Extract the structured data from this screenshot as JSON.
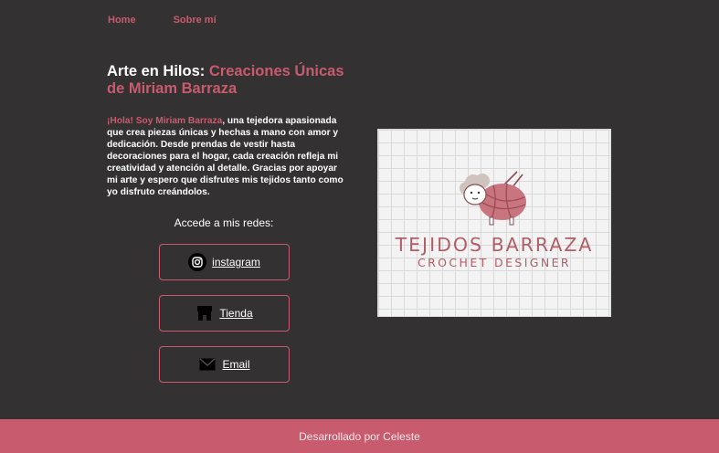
{
  "nav": {
    "home": "Home",
    "about": "Sobre mí"
  },
  "hero": {
    "title_plain": "Arte en Hilos: ",
    "title_accent": "Creaciones Únicas de Miriam Barraza"
  },
  "intro": {
    "greeting": "¡Hola! Soy Miriam Barraza",
    "body": ", una tejedora apasionada que crea piezas únicas y hechas a mano con amor y dedicación. Desde prendas de vestir hasta decoraciones para el hogar, cada creación refleja mi creatividad y atención al detalle. Gracias por apoyar mi arte y espero que disfrutes mis tejidos tanto como yo disfruto creándolos."
  },
  "social": {
    "label": "Accede a mis redes:",
    "buttons": [
      {
        "label": "instagram",
        "icon": "instagram-icon"
      },
      {
        "label": "Tienda",
        "icon": "store-icon"
      },
      {
        "label": "Email",
        "icon": "envelope-icon"
      }
    ]
  },
  "logo": {
    "brand": "TEJIDOS BARRAZA",
    "subtitle": "CROCHET DESIGNER",
    "icon": "sheep-yarn-icon",
    "color": "#b35d66"
  },
  "footer": {
    "text": "Desarrollado por Celeste"
  },
  "colors": {
    "background": "#333132",
    "accent": "#c85b6d"
  }
}
